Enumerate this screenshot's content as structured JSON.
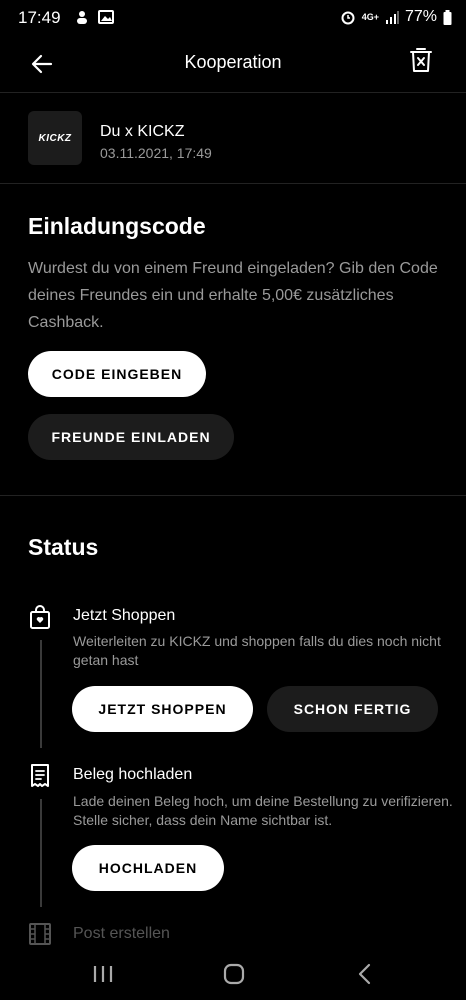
{
  "status_bar": {
    "time": "17:49",
    "battery": "77%",
    "network": "4G+",
    "icons": [
      "notification-icon",
      "image-icon",
      "alarm-icon",
      "signal-icon",
      "battery-icon"
    ]
  },
  "header": {
    "title": "Kooperation",
    "back_icon": "arrow-left-icon",
    "delete_icon": "trash-icon"
  },
  "partner": {
    "logo_text": "KICKZ",
    "name": "Du x KICKZ",
    "date": "03.11.2021, 17:49"
  },
  "invite": {
    "title": "Einladungscode",
    "text": "Wurdest du von einem Freund eingeladen? Gib den Code deines Freundes ein und erhalte 5,00€ zusätzliches Cashback.",
    "enter_code_label": "CODE EINGEBEN",
    "invite_friends_label": "FREUNDE EINLADEN"
  },
  "status": {
    "title": "Status",
    "steps": [
      {
        "icon": "shopping-bag-icon",
        "title": "Jetzt Shoppen",
        "description": "Weiterleiten zu KICKZ und shoppen falls du dies noch nicht getan hast",
        "primary_label": "JETZT SHOPPEN",
        "secondary_label": "SCHON FERTIG"
      },
      {
        "icon": "receipt-icon",
        "title": "Beleg hochladen",
        "description": "Lade deinen Beleg hoch, um deine Bestellung zu verifizieren. Stelle sicher, dass dein Name sichtbar ist.",
        "primary_label": "HOCHLADEN"
      },
      {
        "icon": "film-icon",
        "title": "Post erstellen"
      }
    ]
  },
  "nav": {
    "icons": [
      "recent-apps-icon",
      "home-icon",
      "back-icon"
    ]
  },
  "colors": {
    "background": "#000000",
    "text": "#ffffff",
    "muted_text": "#9a9a9a",
    "dark_button": "#1c1c1c",
    "light_button": "#ffffff"
  }
}
